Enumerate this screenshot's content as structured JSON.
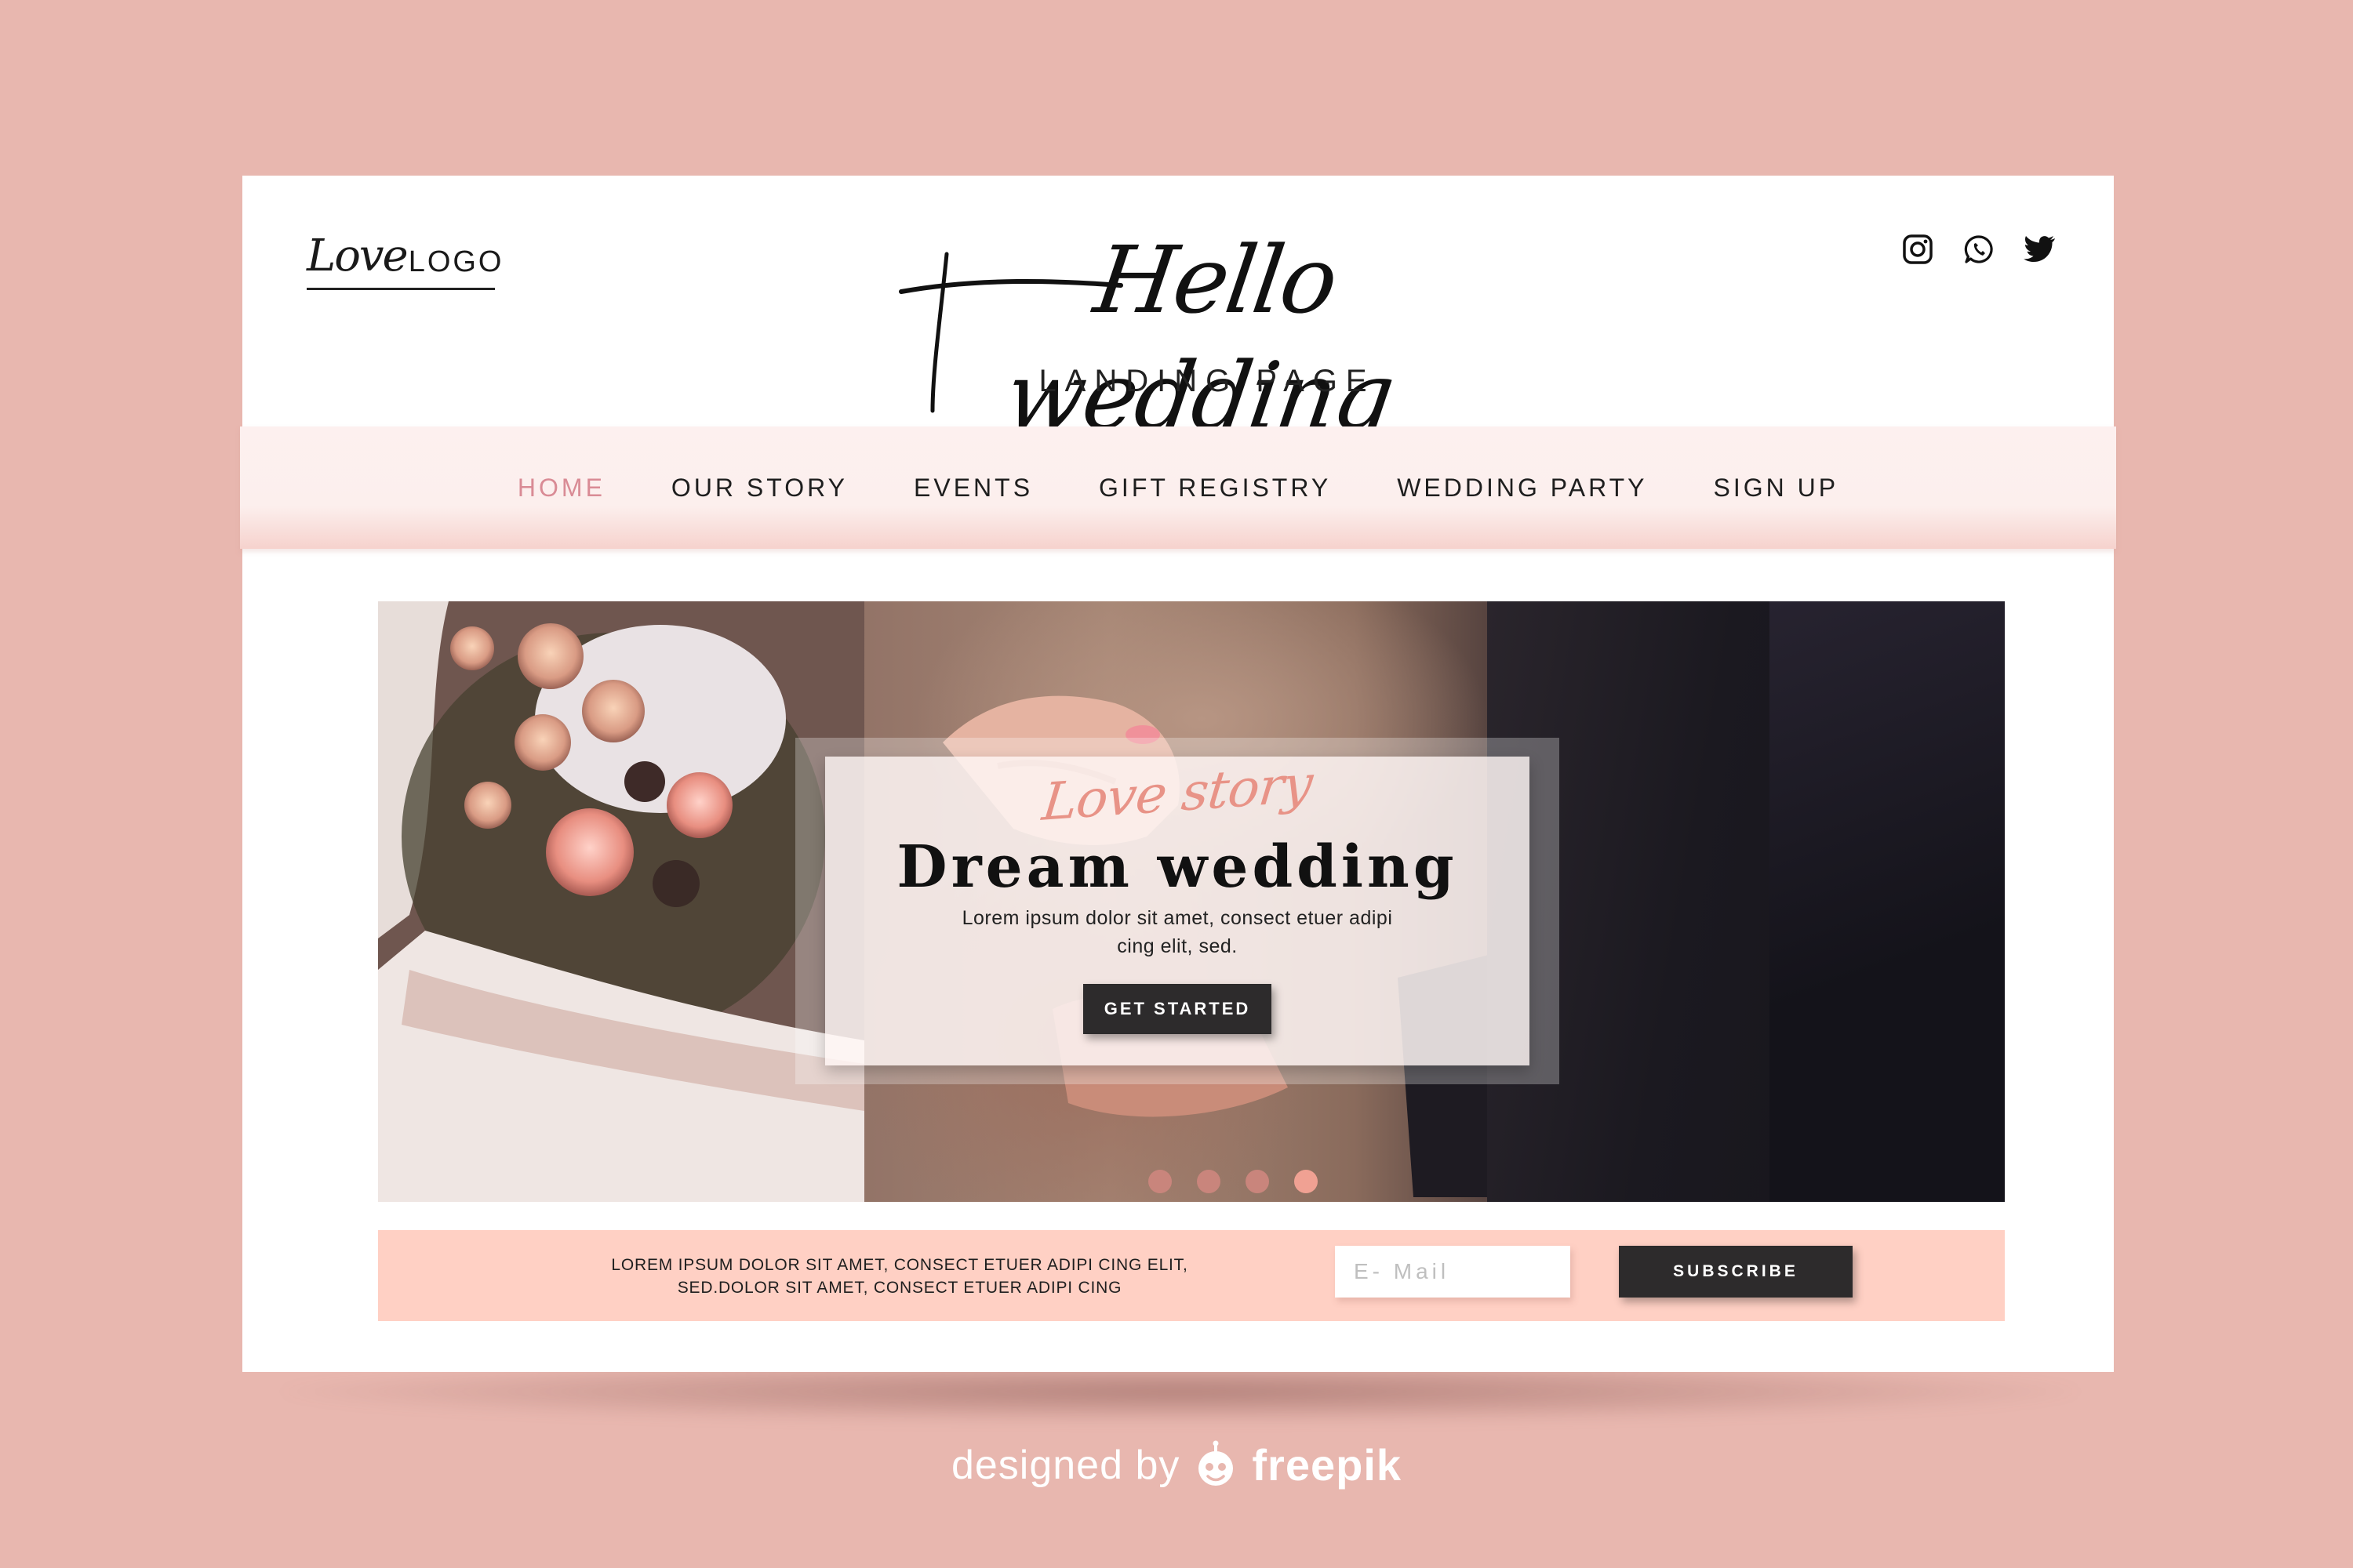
{
  "header": {
    "logo_script": "Love",
    "logo_word": "LOGO",
    "title": "Hello wedding",
    "subtitle": "LANDING PAGE",
    "social_icons": [
      "instagram-icon",
      "whatsapp-icon",
      "twitter-icon"
    ]
  },
  "nav": {
    "items": [
      {
        "label": "HOME",
        "active": true
      },
      {
        "label": "OUR STORY",
        "active": false
      },
      {
        "label": "EVENTS",
        "active": false
      },
      {
        "label": "GIFT REGISTRY",
        "active": false
      },
      {
        "label": "WEDDING PARTY",
        "active": false
      },
      {
        "label": "SIGN UP",
        "active": false
      }
    ]
  },
  "hero": {
    "script_text": "Love story",
    "title": "Dream wedding",
    "body": "Lorem ipsum dolor sit amet, consect etuer adipi cing elit, sed.",
    "cta_label": "GET STARTED",
    "slides": 4,
    "active_slide": 4
  },
  "newsletter": {
    "text": "LOREM IPSUM DOLOR SIT AMET, CONSECT ETUER ADIPI CING ELIT, SED.DOLOR SIT AMET, CONSECT ETUER ADIPI CING",
    "email_placeholder": "E- Mail",
    "button_label": "SUBSCRIBE"
  },
  "credit": {
    "prefix": "designed by",
    "brand": "freepik"
  },
  "colors": {
    "page_bg": "#e8b7af",
    "nav_active": "#d98b95",
    "accent_script": "#e89387",
    "newsletter_bg": "#ffd0c4",
    "button_dark": "#2d2b2c"
  }
}
